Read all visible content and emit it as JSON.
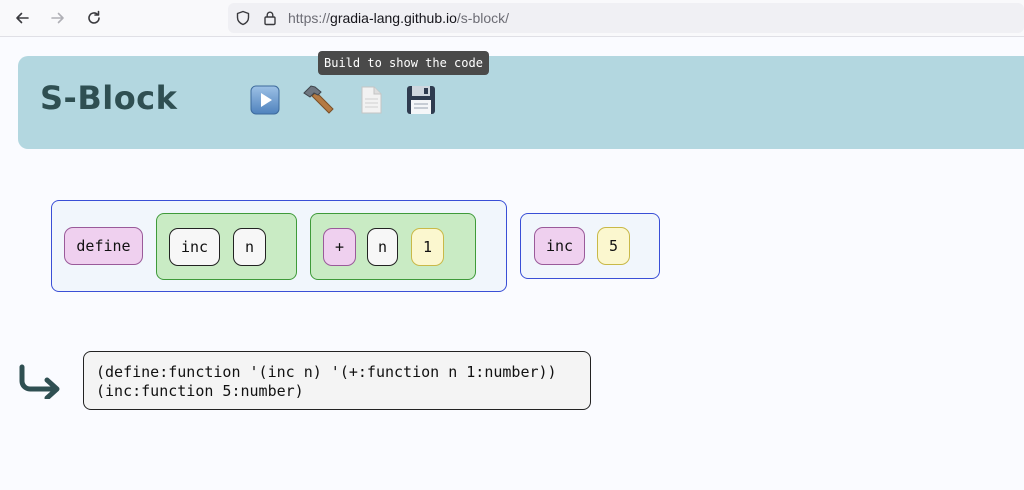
{
  "browser": {
    "url_prefix": "https://",
    "url_host": "gradia-lang.github.io",
    "url_path": "/s-block/",
    "icons": [
      "back-arrow-icon",
      "forward-arrow-icon",
      "reload-icon",
      "shield-icon",
      "lock-icon"
    ]
  },
  "app": {
    "title": "S-Block",
    "header_color": "#b3d7e0",
    "toolbar": {
      "run_icon": "play-icon",
      "build_icon": "hammer-icon",
      "new_icon": "document-icon",
      "save_icon": "floppy-disk-icon"
    },
    "tooltip": "Build to show the code"
  },
  "workspace": {
    "expr1": {
      "head": "define",
      "params": [
        "inc",
        "n"
      ],
      "body": [
        "+",
        "n",
        "1"
      ]
    },
    "expr2": {
      "head": "inc",
      "arg": "5"
    }
  },
  "output": {
    "arrow_icon": "return-arrow-icon",
    "line1": "(define:function '(inc n) '(+:function n 1:number))",
    "line2": "(inc:function 5:number)"
  },
  "colors": {
    "function_atom": "#efd0ef",
    "symbol_atom": "#f7f7f7",
    "number_atom": "#fbf7cf",
    "sublist": "#c9ebc4",
    "expr_border": "#3a4fd6"
  }
}
